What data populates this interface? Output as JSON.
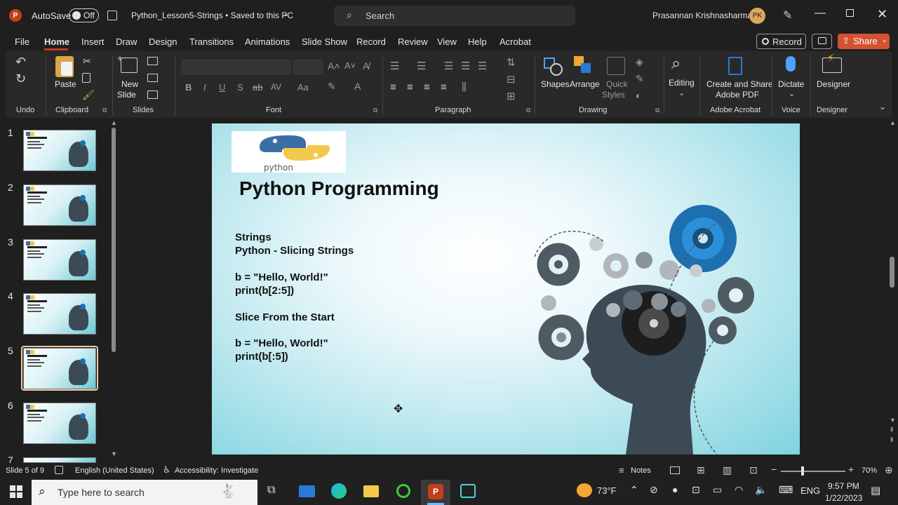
{
  "titlebar": {
    "autosave_label": "AutoSave",
    "autosave_state": "Off",
    "doc_title": "Python_Lesson5-Strings • Saved to this PC",
    "search_placeholder": "Search",
    "user_name": "Prasannan Krishnasharma",
    "user_initials": "PK"
  },
  "menu": {
    "items": [
      "File",
      "Home",
      "Insert",
      "Draw",
      "Design",
      "Transitions",
      "Animations",
      "Slide Show",
      "Record",
      "Review",
      "View",
      "Help",
      "Acrobat"
    ],
    "active": "Home",
    "record_button": "Record",
    "share_button": "Share"
  },
  "ribbon": {
    "groups": [
      "Undo",
      "Clipboard",
      "Slides",
      "Font",
      "Paragraph",
      "Drawing",
      "Adobe Acrobat",
      "Voice",
      "Designer"
    ],
    "paste": "Paste",
    "new_slide": "New",
    "new_slide2": "Slide",
    "shapes": "Shapes",
    "arrange": "Arrange",
    "quick_styles": "Quick",
    "quick_styles2": "Styles",
    "editing": "Editing",
    "create_share": "Create and Share",
    "adobe_pdf": "Adobe PDF",
    "dictate": "Dictate",
    "designer": "Designer"
  },
  "slide_pane": {
    "numbers": [
      "1",
      "2",
      "3",
      "4",
      "5",
      "6",
      "7"
    ],
    "selected": 5
  },
  "slide": {
    "logo_text": "python",
    "title": "Python Programming",
    "lines": [
      "Strings",
      "Python - Slicing Strings",
      "b = \"Hello, World!\"",
      "print(b[2:5])",
      "Slice From the Start",
      "b = \"Hello, World!\"",
      "print(b[:5])"
    ]
  },
  "status": {
    "slide_of": "Slide 5 of 9",
    "language": "English (United States)",
    "accessibility": "Accessibility: Investigate",
    "notes": "Notes",
    "zoom": "70%"
  },
  "taskbar": {
    "search_placeholder": "Type here to search",
    "weather": "73°F",
    "lang": "ENG",
    "time": "9:57 PM",
    "date": "1/22/2023"
  },
  "colors": {
    "accent_red": "#c43e1c",
    "share_orange": "#d35230",
    "slide_teal": "#7fd3df"
  }
}
